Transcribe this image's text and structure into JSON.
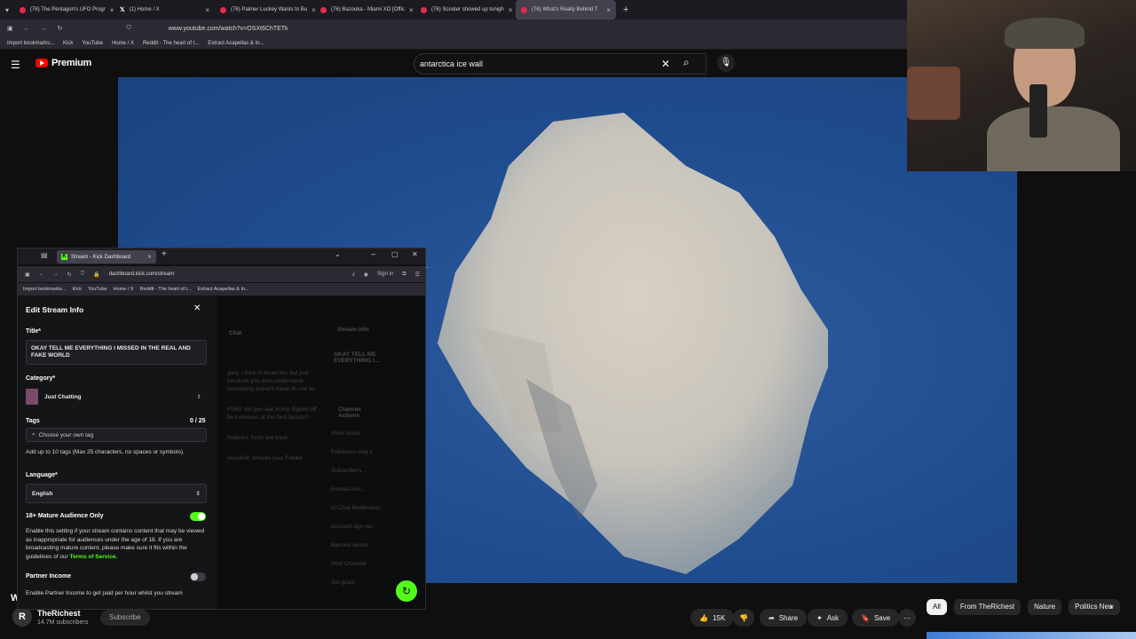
{
  "browser": {
    "tabs": [
      {
        "title": "(76) The Pentagon's UFO Progr",
        "icon": "youtube"
      },
      {
        "title": "(1) Home / X",
        "icon": "x"
      },
      {
        "title": "(76) Palmer Luckey Wants to Bu",
        "icon": "youtube"
      },
      {
        "title": "(76) Bazooka - Miami XO [Offic",
        "icon": "youtube"
      },
      {
        "title": "(76) Scooter showed up tonigh",
        "icon": "youtube"
      },
      {
        "title": "(76) What's Really Behind T",
        "icon": "youtube",
        "active": true
      }
    ],
    "new_tab": "+",
    "url": "www.youtube.com/watch?v=OSXt6ChTETk",
    "bookmarks": [
      "Import bookmarks...",
      "Kick",
      "YouTube",
      "Home / X",
      "Reddit - The heart of t...",
      "Extract Acapellas & In..."
    ]
  },
  "youtube": {
    "logo_text": "Premium",
    "search_value": "antarctica ice wall",
    "channel": {
      "name": "TheRichest",
      "subscribers": "14.7M subscribers",
      "avatar_letter": "R"
    },
    "subscribe_label": "Subscribe",
    "actions": {
      "likes": "15K",
      "share": "Share",
      "ask": "Ask",
      "save": "Save",
      "more": "⋯"
    },
    "chips": [
      "All",
      "From TheRichest",
      "Nature",
      "Politics New"
    ],
    "partial_title_letter": "W"
  },
  "kick_window": {
    "tab_title": "Stream - Kick Dashboard",
    "url": "dashboard.kick.com/stream",
    "sign_in": "Sign in",
    "bookmarks": [
      "Import bookmarks...",
      "Kick",
      "YouTube",
      "Home / X",
      "Reddit - The heart of t...",
      "Extract Acapellas & In..."
    ],
    "edit_panel": {
      "heading": "Edit Stream Info",
      "title_label": "Title*",
      "title_value": "OKAY TELL ME EVERYTHING I MISSED IN THE REAL AND FAKE WORLD",
      "category_label": "Category*",
      "category_value": "Just Chatting",
      "tags_label": "Tags",
      "tags_count": "0 / 25",
      "tags_placeholder": "Choose your own tag",
      "tags_help": "Add up to 10 tags (Max 25 characters, no spaces or symbols).",
      "language_label": "Language*",
      "language_value": "English",
      "mature_label": "18+ Mature Audience Only",
      "mature_on": true,
      "mature_desc": "Enable this setting if your stream contains content that may be viewed as inappropriate for audiences under the age of 18. If you are broadcasting mature content, please make sure it fits within the guidelines of our",
      "mature_link": "Terms of Service.",
      "partner_label": "Partner Income",
      "partner_on": false,
      "partner_desc": "Enable Partner Income to get paid per hour whilst you stream"
    },
    "background": {
      "chat_title": "Chat",
      "stream_info_title": "Stream Info",
      "stream_info_preview": "OKAY TELL ME EVERYTHING I...",
      "channel_actions_title": "Channel Actions",
      "actions": [
        "Slow mode",
        "Followers-only c",
        "Subscribers...",
        "Emotes-onl...",
        "AI Chat Moderation",
        "Account age res",
        "Banned words",
        "Host Channel",
        "Set goals"
      ],
      "chat_lines": [
        "gary: i think is know this but just because you dont understand something doesn't mean its not rel",
        "FS60: did you see trump flipped off ford workers at the ford factory?",
        "fredmini: fords are trash",
        "virus404: wheres your Fowler"
      ]
    }
  },
  "colors": {
    "kick_green": "#53fc18",
    "yt_red": "#ff0000",
    "ocean": "#2a5599"
  }
}
